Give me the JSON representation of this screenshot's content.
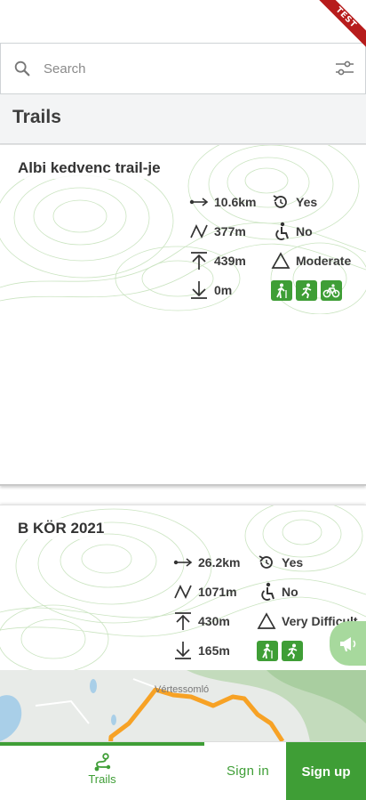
{
  "ribbon": {
    "label": "TEST"
  },
  "search": {
    "placeholder": "Search"
  },
  "section": {
    "title": "Trails"
  },
  "trails": [
    {
      "name": "Albi kedvenc trail-je",
      "distance": "10.6km",
      "elevation_change": "377m",
      "max_elevation": "439m",
      "min_elevation": "0m",
      "loop": "Yes",
      "accessible": "No",
      "difficulty": "Moderate",
      "activities": [
        "hiking-icon",
        "running-icon",
        "cycling-icon"
      ]
    },
    {
      "name": "B KÖR 2021",
      "distance": "26.2km",
      "elevation_change": "1071m",
      "max_elevation": "430m",
      "min_elevation": "165m",
      "loop": "Yes",
      "accessible": "No",
      "difficulty": "Very Difficult",
      "activities": [
        "hiking-icon",
        "running-icon"
      ],
      "map": {
        "place_label": "Vértessomló"
      }
    }
  ],
  "bottom_nav": {
    "trails_label": "Trails",
    "signin_label": "Sign in",
    "signup_label": "Sign up"
  },
  "colors": {
    "accent": "#3f9e36",
    "route": "#f7a225",
    "ribbon": "#b71c1c"
  }
}
